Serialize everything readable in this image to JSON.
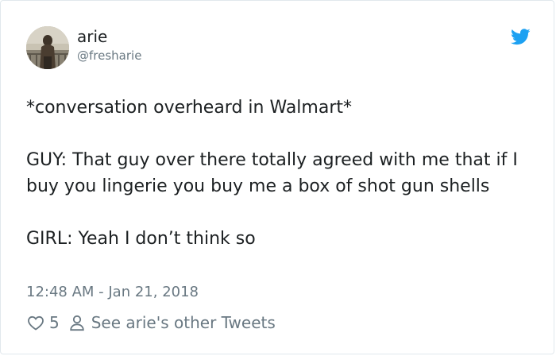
{
  "author": {
    "display_name": "arie",
    "handle": "@fresharie"
  },
  "tweet": {
    "lines": [
      "*conversation overheard in Walmart*",
      "GUY: That guy over there totally agreed with me that if I buy you lingerie you buy me a box of shot gun shells",
      "GIRL: Yeah I don’t think so"
    ],
    "timestamp": "12:48 AM - Jan 21, 2018"
  },
  "actions": {
    "likes": "5",
    "other_tweets_label": "See arie's other Tweets"
  },
  "icons": {
    "brand": "twitter-bird-icon",
    "like": "heart-icon",
    "profile": "person-icon"
  },
  "colors": {
    "brand_blue": "#1da1f2",
    "text_primary": "#1c2022",
    "text_secondary": "#697882",
    "border": "#e1e8ed"
  }
}
